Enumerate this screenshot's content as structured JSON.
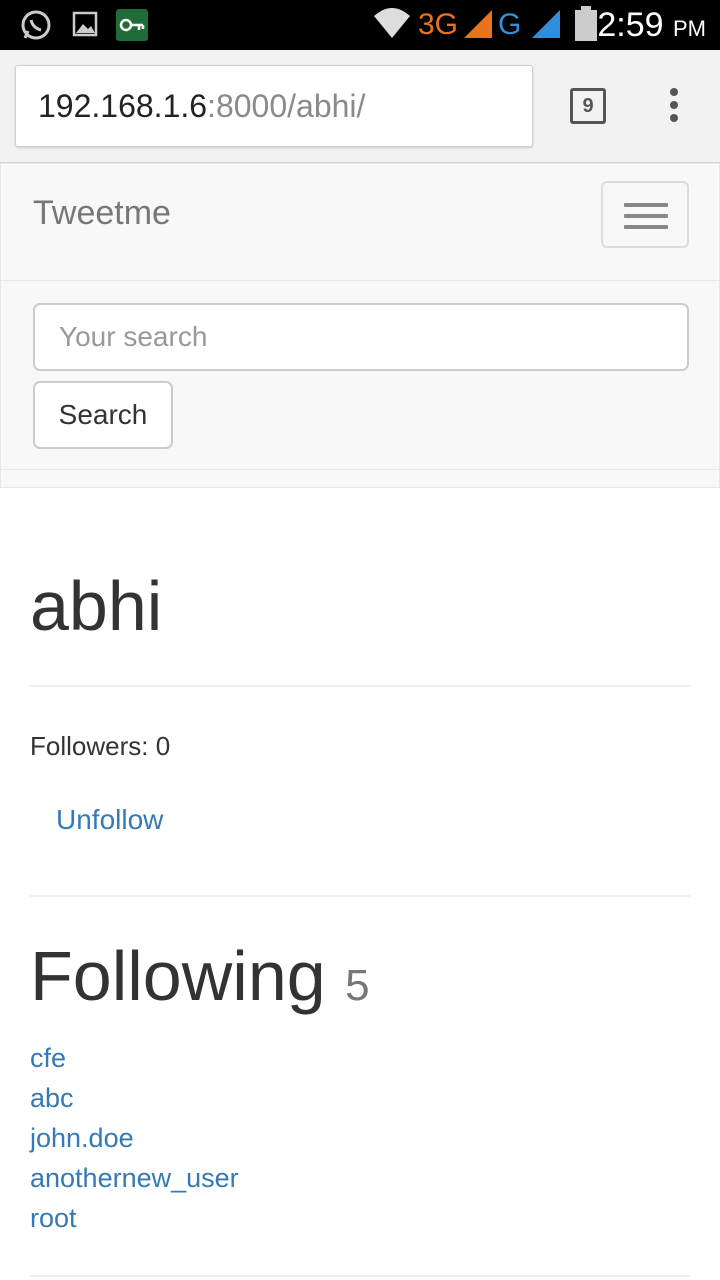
{
  "status_bar": {
    "time": "2:59",
    "ampm": "PM",
    "network_3g": "3G",
    "network_g": "G",
    "icons": [
      "whatsapp-icon",
      "gallery-icon",
      "vpn-key-icon",
      "wifi-icon",
      "signal-icon",
      "signal-icon",
      "battery-icon"
    ]
  },
  "browser": {
    "url_host": "192.168.1.6",
    "url_path": ":8000/abhi/",
    "tab_count": "9"
  },
  "navbar": {
    "brand": "Tweetme",
    "search": {
      "placeholder": "Your search",
      "button_label": "Search"
    }
  },
  "profile": {
    "username": "abhi",
    "followers_text": "Followers: 0",
    "unfollow_label": "Unfollow",
    "following_heading": "Following",
    "following_count": "5",
    "following": [
      "cfe",
      "abc",
      "john.doe",
      "anothernew_user",
      "root"
    ]
  },
  "colors": {
    "link": "#337ab7",
    "navbar_bg": "#f8f8f8",
    "net_3g": "#e8731f",
    "net_g": "#2f8fd8"
  }
}
